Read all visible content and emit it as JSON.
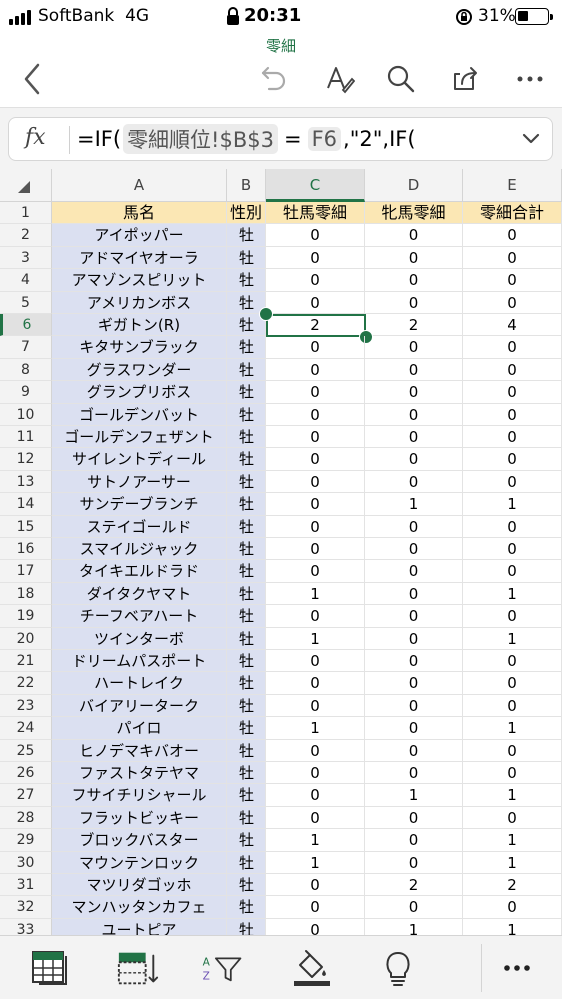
{
  "status_bar": {
    "carrier": "SoftBank",
    "network": "4G",
    "time": "20:31",
    "battery": "31%",
    "battery_level": 0.31
  },
  "document": {
    "title": "零細"
  },
  "toolbar": {
    "back": "back-icon",
    "undo": "undo-icon",
    "format": "text-format-icon",
    "search": "search-icon",
    "share": "share-icon",
    "more": "more-icon"
  },
  "formula_bar": {
    "fx_label": "fx",
    "part1": "=IF(",
    "token1": "零細順位!$B$3",
    "part2": "=",
    "token2": "F6",
    "part3": ",\"2\",IF("
  },
  "columns": [
    "A",
    "B",
    "C",
    "D",
    "E"
  ],
  "selected_column": "C",
  "selected_cell": "C6",
  "header_row": {
    "row": "1",
    "cells": [
      "馬名",
      "性別",
      "牡馬零細",
      "牝馬零細",
      "零細合計"
    ]
  },
  "rows": [
    {
      "n": "2",
      "a": "アイポッパー",
      "b": "牡",
      "c": "0",
      "d": "0",
      "e": "0"
    },
    {
      "n": "3",
      "a": "アドマイヤオーラ",
      "b": "牡",
      "c": "0",
      "d": "0",
      "e": "0"
    },
    {
      "n": "4",
      "a": "アマゾンスピリット",
      "b": "牡",
      "c": "0",
      "d": "0",
      "e": "0"
    },
    {
      "n": "5",
      "a": "アメリカンボス",
      "b": "牡",
      "c": "0",
      "d": "0",
      "e": "0"
    },
    {
      "n": "6",
      "a": "ギガトン(R)",
      "b": "牡",
      "c": "2",
      "d": "2",
      "e": "4"
    },
    {
      "n": "7",
      "a": "キタサンブラック",
      "b": "牡",
      "c": "0",
      "d": "0",
      "e": "0"
    },
    {
      "n": "8",
      "a": "グラスワンダー",
      "b": "牡",
      "c": "0",
      "d": "0",
      "e": "0"
    },
    {
      "n": "9",
      "a": "グランプリボス",
      "b": "牡",
      "c": "0",
      "d": "0",
      "e": "0"
    },
    {
      "n": "10",
      "a": "ゴールデンバット",
      "b": "牡",
      "c": "0",
      "d": "0",
      "e": "0"
    },
    {
      "n": "11",
      "a": "ゴールデンフェザント",
      "b": "牡",
      "c": "0",
      "d": "0",
      "e": "0"
    },
    {
      "n": "12",
      "a": "サイレントディール",
      "b": "牡",
      "c": "0",
      "d": "0",
      "e": "0"
    },
    {
      "n": "13",
      "a": "サトノアーサー",
      "b": "牡",
      "c": "0",
      "d": "0",
      "e": "0"
    },
    {
      "n": "14",
      "a": "サンデーブランチ",
      "b": "牡",
      "c": "0",
      "d": "1",
      "e": "1"
    },
    {
      "n": "15",
      "a": "ステイゴールド",
      "b": "牡",
      "c": "0",
      "d": "0",
      "e": "0"
    },
    {
      "n": "16",
      "a": "スマイルジャック",
      "b": "牡",
      "c": "0",
      "d": "0",
      "e": "0"
    },
    {
      "n": "17",
      "a": "タイキエルドラド",
      "b": "牡",
      "c": "0",
      "d": "0",
      "e": "0"
    },
    {
      "n": "18",
      "a": "ダイタクヤマト",
      "b": "牡",
      "c": "1",
      "d": "0",
      "e": "1"
    },
    {
      "n": "19",
      "a": "チーフベアハート",
      "b": "牡",
      "c": "0",
      "d": "0",
      "e": "0"
    },
    {
      "n": "20",
      "a": "ツインターボ",
      "b": "牡",
      "c": "1",
      "d": "0",
      "e": "1"
    },
    {
      "n": "21",
      "a": "ドリームパスポート",
      "b": "牡",
      "c": "0",
      "d": "0",
      "e": "0"
    },
    {
      "n": "22",
      "a": "ハートレイク",
      "b": "牡",
      "c": "0",
      "d": "0",
      "e": "0"
    },
    {
      "n": "23",
      "a": "バイアリーターク",
      "b": "牡",
      "c": "0",
      "d": "0",
      "e": "0"
    },
    {
      "n": "24",
      "a": "パイロ",
      "b": "牡",
      "c": "1",
      "d": "0",
      "e": "1"
    },
    {
      "n": "25",
      "a": "ヒノデマキバオー",
      "b": "牡",
      "c": "0",
      "d": "0",
      "e": "0"
    },
    {
      "n": "26",
      "a": "ファストタテヤマ",
      "b": "牡",
      "c": "0",
      "d": "0",
      "e": "0"
    },
    {
      "n": "27",
      "a": "フサイチリシャール",
      "b": "牡",
      "c": "0",
      "d": "1",
      "e": "1"
    },
    {
      "n": "28",
      "a": "フラットビッキー",
      "b": "牡",
      "c": "0",
      "d": "0",
      "e": "0"
    },
    {
      "n": "29",
      "a": "ブロックバスター",
      "b": "牡",
      "c": "1",
      "d": "0",
      "e": "1"
    },
    {
      "n": "30",
      "a": "マウンテンロック",
      "b": "牡",
      "c": "1",
      "d": "0",
      "e": "1"
    },
    {
      "n": "31",
      "a": "マツリダゴッホ",
      "b": "牡",
      "c": "0",
      "d": "2",
      "e": "2"
    },
    {
      "n": "32",
      "a": "マンハッタンカフェ",
      "b": "牡",
      "c": "0",
      "d": "0",
      "e": "0"
    },
    {
      "n": "33",
      "a": "ユートピア",
      "b": "牡",
      "c": "0",
      "d": "1",
      "e": "1"
    }
  ],
  "bottom_toolbar": {
    "sheets": "sheets-icon",
    "insert": "insert-rows-icon",
    "sort_filter": "sort-filter-icon",
    "fill": "fill-color-icon",
    "ideas": "lightbulb-icon",
    "more": "more-icon"
  },
  "colors": {
    "accent": "#217346",
    "name_column": "#dbe0f1",
    "header_fill": "#fbe7b4"
  }
}
